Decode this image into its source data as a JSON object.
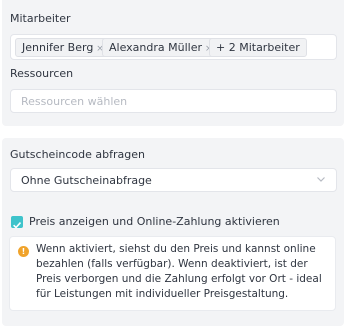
{
  "staff": {
    "label": "Mitarbeiter",
    "chips": [
      {
        "name": "Jennifer Berg",
        "remove": "×"
      },
      {
        "name": "Alexandra Müller",
        "remove": "×"
      }
    ],
    "more_chip": "+ 2 Mitarbeiter"
  },
  "resources": {
    "label": "Ressourcen",
    "placeholder": "Ressourcen wählen"
  },
  "voucher": {
    "label": "Gutscheincode abfragen",
    "selected": "Ohne Gutscheinabfrage",
    "chevron_icon": "chevron-down-icon"
  },
  "price": {
    "checkbox_label": "Preis anzeigen und Online-Zahlung aktivieren",
    "checked": true,
    "info_icon": "warning-icon",
    "info_text": "Wenn aktiviert, siehst du den Preis und kannst online bezahlen (falls verfügbar). Wenn deaktiviert, ist der Preis verborgen und die Zahlung erfolgt vor Ort - ideal für Leistungen mit individueller Preisgestaltung.",
    "accent_color": "#3ec3cb",
    "warning_color": "#f0a32b"
  }
}
